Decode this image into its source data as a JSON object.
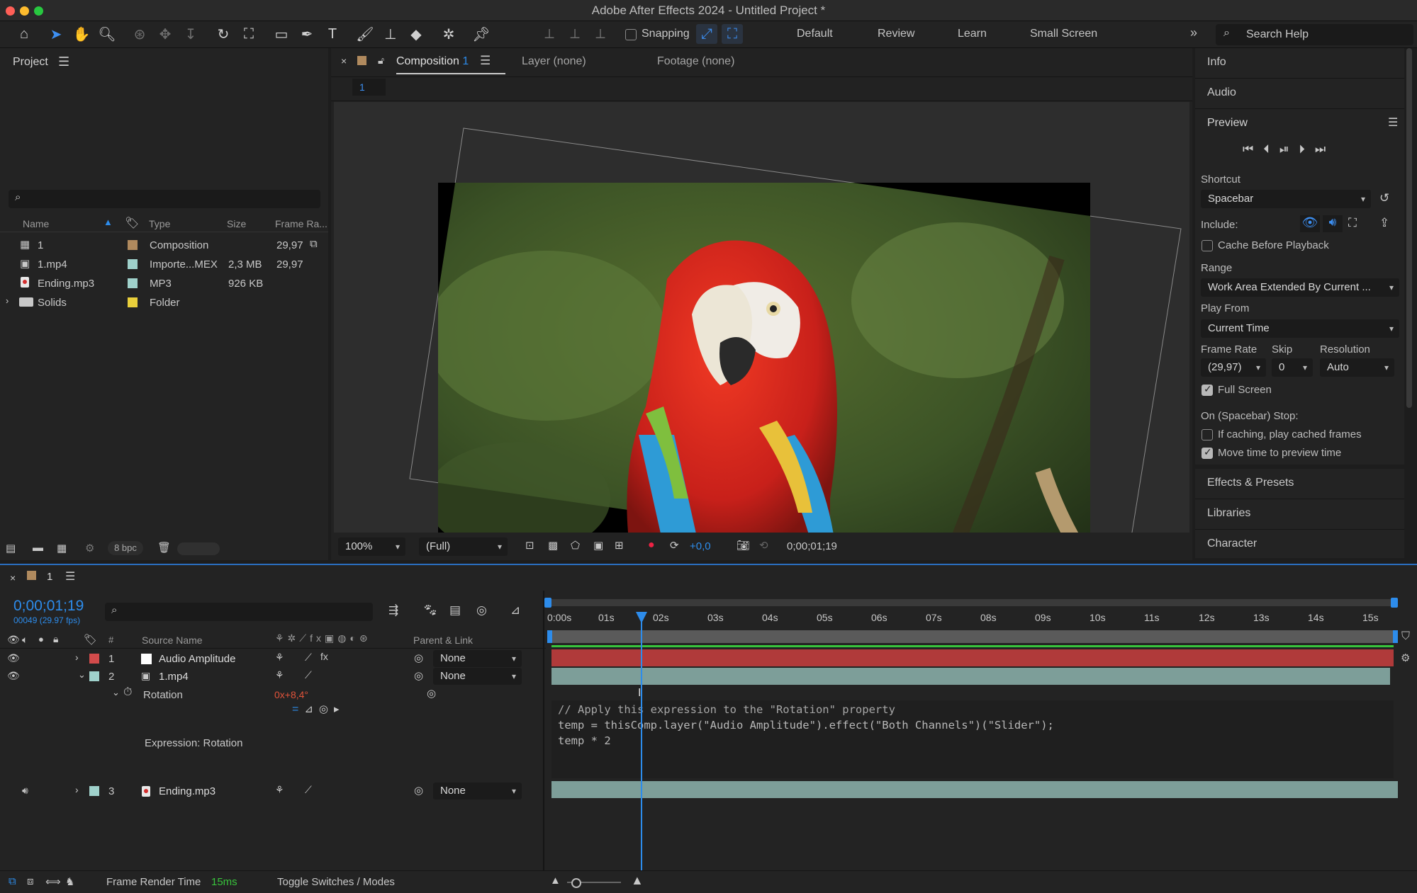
{
  "window": {
    "title": "Adobe After Effects 2024 - Untitled Project *"
  },
  "toolbar": {
    "snapping_label": "Snapping",
    "workspaces": [
      "Default",
      "Review",
      "Learn",
      "Small Screen"
    ],
    "search_placeholder": "Search Help"
  },
  "project": {
    "panel_title": "Project",
    "columns": {
      "name": "Name",
      "type": "Type",
      "size": "Size",
      "frame_rate": "Frame Ra..."
    },
    "items": [
      {
        "name": "1",
        "type": "Composition",
        "size": "",
        "fps": "29,97",
        "label_color": "#b08a5e"
      },
      {
        "name": "1.mp4",
        "type": "Importe...MEX",
        "size": "2,3 MB",
        "fps": "29,97",
        "label_color": "#9fd1cb"
      },
      {
        "name": "Ending.mp3",
        "type": "MP3",
        "size": "926 KB",
        "fps": "",
        "label_color": "#9fd1cb"
      },
      {
        "name": "Solids",
        "type": "Folder",
        "size": "",
        "fps": "",
        "label_color": "#e9cf3b"
      }
    ],
    "bpc": "8 bpc"
  },
  "comp": {
    "tabs": {
      "composition": "Composition",
      "comp_number": "1",
      "layer": "Layer (none)",
      "footage": "Footage (none)"
    },
    "breadcrumb": "1",
    "zoom": "100%",
    "resolution": "(Full)",
    "exposure": "+0,0",
    "timecode": "0;00;01;19"
  },
  "right_panel": {
    "info": "Info",
    "audio": "Audio",
    "preview": "Preview",
    "shortcut_label": "Shortcut",
    "shortcut_value": "Spacebar",
    "include_label": "Include:",
    "cache_label": "Cache Before Playback",
    "range_label": "Range",
    "range_value": "Work Area Extended By Current ...",
    "play_from_label": "Play From",
    "play_from_value": "Current Time",
    "frame_rate_label": "Frame Rate",
    "skip_label": "Skip",
    "resolution_label": "Resolution",
    "frame_rate_value": "(29,97)",
    "skip_value": "0",
    "resolution_value": "Auto",
    "full_screen_label": "Full Screen",
    "stop_label": "On (Spacebar) Stop:",
    "if_caching_label": "If caching, play cached frames",
    "move_time_label": "Move time to preview time",
    "effects_presets": "Effects & Presets",
    "libraries": "Libraries",
    "character": "Character"
  },
  "timeline": {
    "tab_label": "1",
    "current_time": "0;00;01;19",
    "frame_info": "00049 (29.97 fps)",
    "col_source_name": "Source Name",
    "col_parent": "Parent & Link",
    "col_num": "#",
    "ruler": [
      "0:00s",
      "01s",
      "02s",
      "03s",
      "04s",
      "05s",
      "06s",
      "07s",
      "08s",
      "09s",
      "10s",
      "11s",
      "12s",
      "13s",
      "14s",
      "15s"
    ],
    "layers": [
      {
        "num": "1",
        "name": "Audio Amplitude",
        "parent": "None",
        "label_color": "#d24b4b"
      },
      {
        "num": "2",
        "name": "1.mp4",
        "parent": "None",
        "label_color": "#9fd1cb"
      },
      {
        "num": "3",
        "name": "Ending.mp3",
        "parent": "None",
        "label_color": "#9fd1cb"
      }
    ],
    "property_name": "Rotation",
    "property_value": "0x+8,4°",
    "expression_label": "Expression: Rotation",
    "expression_lines": [
      "// Apply this expression to the \"Rotation\" property",
      "temp = thisComp.layer(\"Audio Amplitude\").effect(\"Both Channels\")(\"Slider\");",
      "temp * 2"
    ],
    "render_time_label": "Frame Render Time",
    "render_time_value": "15ms",
    "toggle_label": "Toggle Switches / Modes"
  }
}
